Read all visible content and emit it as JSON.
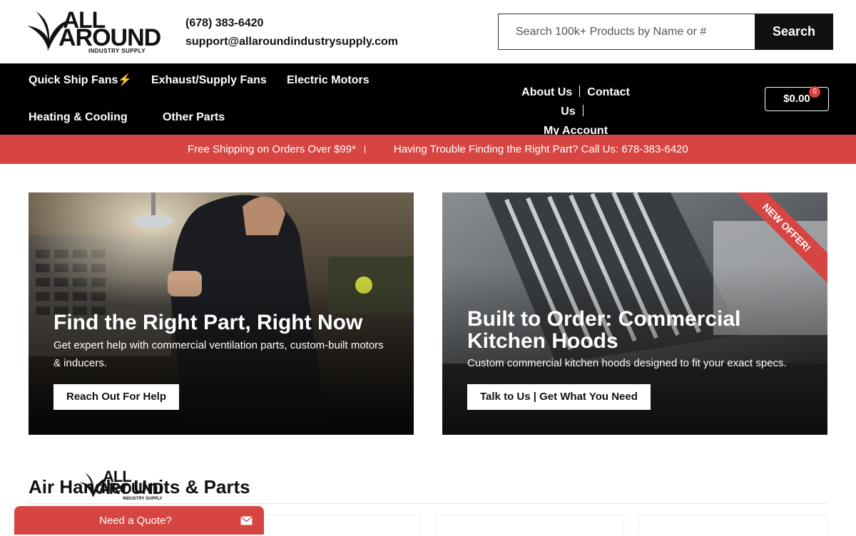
{
  "brand": {
    "logo_line1": "ALL",
    "logo_line2": "AROUND",
    "logo_sub": "INDUSTRY SUPPLY"
  },
  "contact": {
    "phone": "(678) 383-6420",
    "email": "support@allaroundindustrysupply.com"
  },
  "search": {
    "placeholder": "Search 100k+ Products by Name or #",
    "button_label": "Search"
  },
  "nav": {
    "items": [
      {
        "label": "Quick Ship Fans⚡"
      },
      {
        "label": "Exhaust/Supply Fans"
      },
      {
        "label": "Electric Motors"
      },
      {
        "label": "Heating & Cooling"
      },
      {
        "label": "Other Parts"
      }
    ],
    "util": {
      "about": "About Us",
      "contact": "Contact Us",
      "account": "My Account"
    },
    "cart": {
      "total": "$0.00",
      "count": "0"
    }
  },
  "promo": {
    "message1": "Free Shipping on Orders Over $99*",
    "message2": "Having Trouble Finding the Right Part? Call Us: 678-383-6420"
  },
  "heroes": [
    {
      "title": "Find the Right Part, Right Now",
      "text": "Get expert help with commercial ventilation parts, custom-built motors & inducers.",
      "button": "Reach Out For Help"
    },
    {
      "title": "Built to Order: Commercial Kitchen Hoods",
      "text": "Custom commercial kitchen hoods designed to fit your exact specs.",
      "button": "Talk to Us | Get What You Need",
      "ribbon": "NEW OFFER!"
    }
  ],
  "section": {
    "title": "Air Handler Units & Parts"
  },
  "quote_widget": {
    "label": "Need a Quote?"
  },
  "colors": {
    "accent_red": "#d64541",
    "nav_black": "#000000"
  },
  "icons": {
    "quote": "envelope-icon",
    "logo": "leaf-logo-icon"
  }
}
